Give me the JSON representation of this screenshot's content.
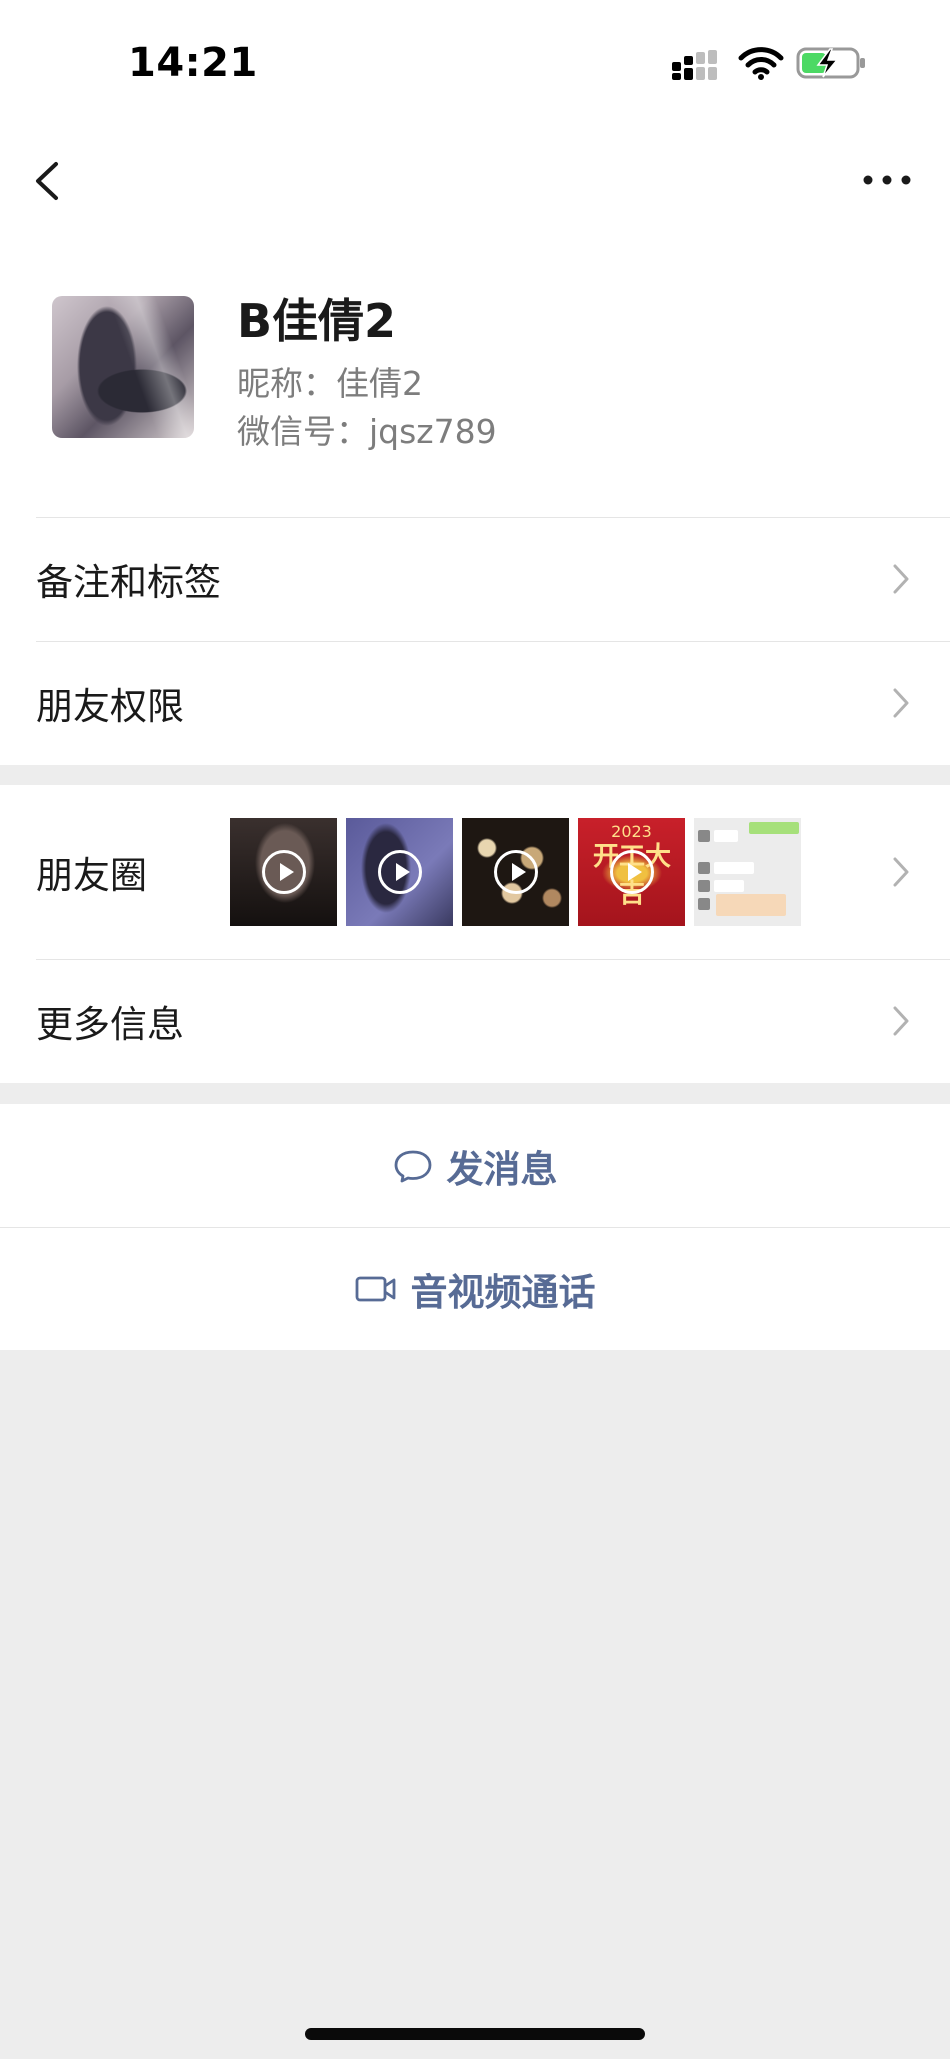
{
  "status_bar": {
    "time": "14:21"
  },
  "profile": {
    "name": "B佳倩2",
    "nickname": "昵称：佳倩2",
    "wechat_id": "微信号：jqsz789"
  },
  "rows": {
    "remarks_tags": "备注和标签",
    "friend_permissions": "朋友权限",
    "moments": "朋友圈",
    "more_info": "更多信息"
  },
  "moments_thumbs": {
    "poster_title": "开工大吉",
    "poster_year": "2023"
  },
  "actions": {
    "send_message": "发消息",
    "av_call": "音视频通话"
  },
  "colors": {
    "link_blue": "#576b95",
    "background": "#ededed"
  }
}
